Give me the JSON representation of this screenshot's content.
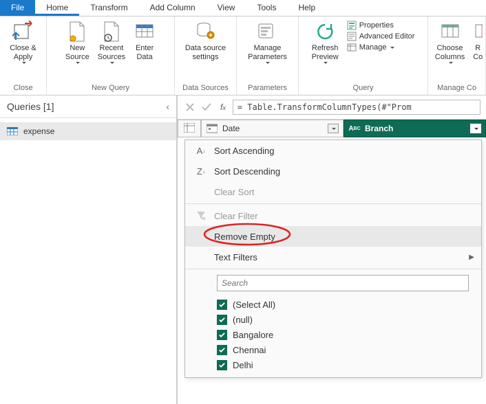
{
  "menu": {
    "file": "File",
    "home": "Home",
    "transform": "Transform",
    "add_column": "Add Column",
    "view": "View",
    "tools": "Tools",
    "help": "Help"
  },
  "ribbon": {
    "close": {
      "label": "Close &\nApply",
      "group": "Close"
    },
    "newquery": {
      "new_source": "New\nSource",
      "recent_sources": "Recent\nSources",
      "enter_data": "Enter\nData",
      "group": "New Query"
    },
    "datasources": {
      "settings": "Data source\nsettings",
      "group": "Data Sources"
    },
    "parameters": {
      "manage": "Manage\nParameters",
      "group": "Parameters"
    },
    "query": {
      "refresh": "Refresh\nPreview",
      "properties": "Properties",
      "advanced": "Advanced Editor",
      "manage": "Manage",
      "group": "Query"
    },
    "managecols": {
      "choose": "Choose\nColumns",
      "remove": "R\nCo",
      "group": "Manage Co"
    }
  },
  "queries": {
    "title": "Queries [1]",
    "items": [
      "expense"
    ]
  },
  "formula": "= Table.TransformColumnTypes(#\"Prom",
  "columns": {
    "date": "Date",
    "branch": "Branch"
  },
  "dropdown": {
    "sort_asc": "Sort Ascending",
    "sort_desc": "Sort Descending",
    "clear_sort": "Clear Sort",
    "clear_filter": "Clear Filter",
    "remove_empty": "Remove Empty",
    "text_filters": "Text Filters",
    "search_placeholder": "Search",
    "checks": [
      "(Select All)",
      "(null)",
      "Bangalore",
      "Chennai",
      "Delhi"
    ]
  }
}
